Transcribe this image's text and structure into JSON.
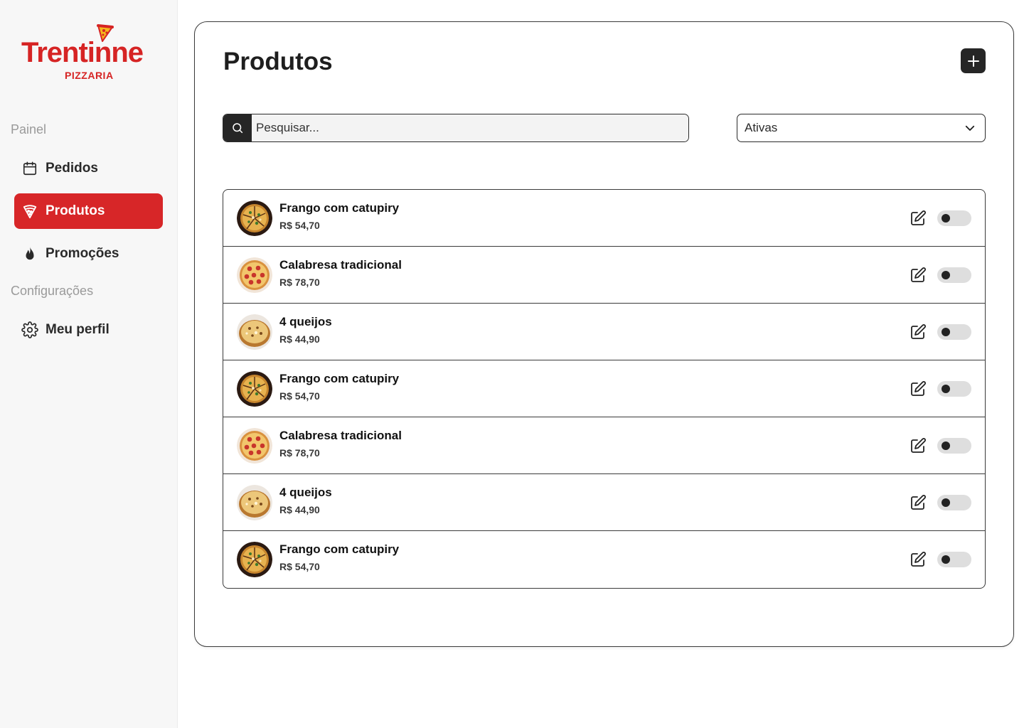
{
  "brand": {
    "name": "Trentinne",
    "subtitle": "PIZZARIA",
    "color": "#d62424"
  },
  "sidebar": {
    "sections": [
      {
        "label": "Painel"
      },
      {
        "label": "Configurações"
      }
    ],
    "items": [
      {
        "label": "Pedidos",
        "icon": "calendar-icon",
        "active": false
      },
      {
        "label": "Produtos",
        "icon": "pizza-slice-icon",
        "active": true
      },
      {
        "label": "Promoções",
        "icon": "flame-icon",
        "active": false
      },
      {
        "label": "Meu perfil",
        "icon": "gear-icon",
        "active": false
      }
    ],
    "active_color": "#d72628"
  },
  "main": {
    "title": "Produtos",
    "add_icon": "plus-icon",
    "search": {
      "placeholder": "Pesquisar...",
      "value": "",
      "icon": "search-icon"
    },
    "filter": {
      "selected": "Ativas",
      "icon": "chevron-down-icon"
    },
    "products": [
      {
        "name": "Frango com catupiry",
        "price": "R$ 54,70",
        "enabled": false
      },
      {
        "name": "Calabresa tradicional",
        "price": "R$ 78,70",
        "enabled": false
      },
      {
        "name": "4 queijos",
        "price": "R$ 44,90",
        "enabled": false
      },
      {
        "name": "Frango com catupiry",
        "price": "R$ 54,70",
        "enabled": false
      },
      {
        "name": "Calabresa tradicional",
        "price": "R$ 78,70",
        "enabled": false
      },
      {
        "name": "4 queijos",
        "price": "R$ 44,90",
        "enabled": false
      },
      {
        "name": "Frango com catupiry",
        "price": "R$ 54,70",
        "enabled": false
      }
    ]
  }
}
